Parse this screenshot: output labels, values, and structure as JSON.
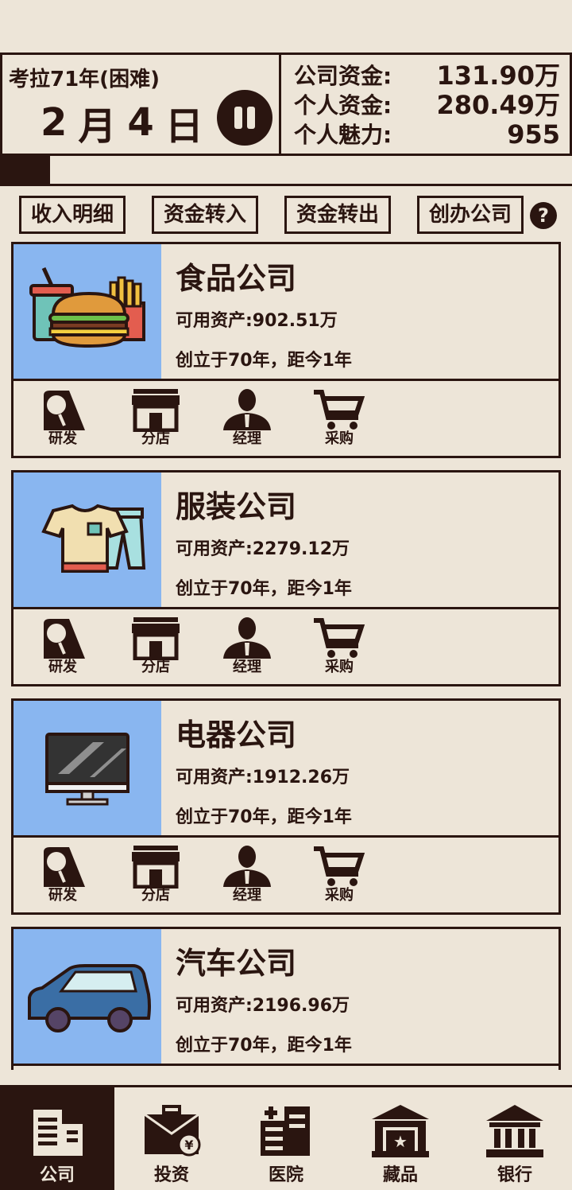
{
  "header": {
    "game_title": "考拉71年(困难)",
    "date": {
      "month": "2",
      "month_unit": "月",
      "day": "4",
      "day_unit": "日"
    },
    "stats": [
      {
        "label": "公司资金:",
        "value": "131.90万"
      },
      {
        "label": "个人资金:",
        "value": "280.49万"
      },
      {
        "label": "个人魅力:",
        "value": "955"
      }
    ],
    "progress": 0.088
  },
  "actions": {
    "income_detail": "收入明细",
    "fund_in": "资金转入",
    "fund_out": "资金转出",
    "create_company": "创办公司"
  },
  "companies": [
    {
      "name": "食品公司",
      "asset": "可用资产:902.51万",
      "founded": "创立于70年，距今1年",
      "icon": "burger-fries-drink-icon"
    },
    {
      "name": "服装公司",
      "asset": "可用资产:2279.12万",
      "founded": "创立于70年，距今1年",
      "icon": "tshirt-jeans-icon"
    },
    {
      "name": "电器公司",
      "asset": "可用资产:1912.26万",
      "founded": "创立于70年，距今1年",
      "icon": "monitor-icon"
    },
    {
      "name": "汽车公司",
      "asset": "可用资产:2196.96万",
      "founded": "创立于70年，距今1年",
      "icon": "car-icon"
    }
  ],
  "tools": {
    "research": "研发",
    "branch": "分店",
    "manager": "经理",
    "purchase": "采购"
  },
  "nav": {
    "company": "公司",
    "invest": "投资",
    "hospital": "医院",
    "collection": "藏品",
    "bank": "银行"
  },
  "colors": {
    "background": "#ede5d8",
    "ink": "#2a1510",
    "card_image_bg": "#89b6f0"
  }
}
